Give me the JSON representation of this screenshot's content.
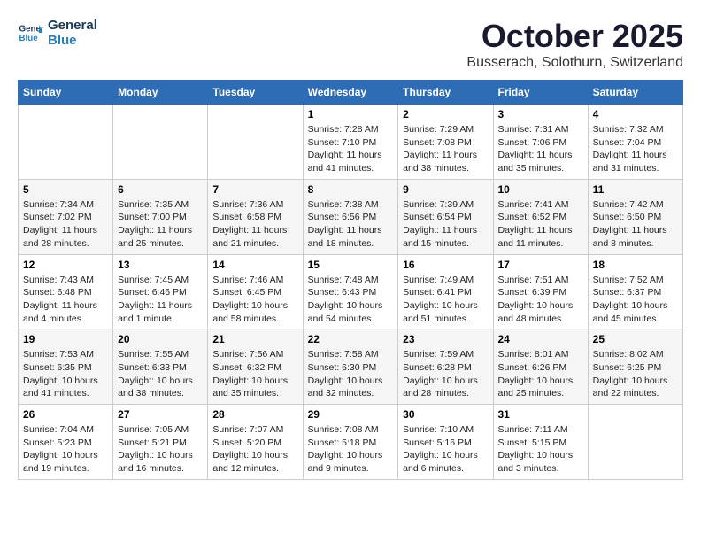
{
  "header": {
    "logo_line1": "General",
    "logo_line2": "Blue",
    "month": "October 2025",
    "location": "Busserach, Solothurn, Switzerland"
  },
  "days_of_week": [
    "Sunday",
    "Monday",
    "Tuesday",
    "Wednesday",
    "Thursday",
    "Friday",
    "Saturday"
  ],
  "weeks": [
    [
      {
        "day": "",
        "info": ""
      },
      {
        "day": "",
        "info": ""
      },
      {
        "day": "",
        "info": ""
      },
      {
        "day": "1",
        "sunrise": "7:28 AM",
        "sunset": "7:10 PM",
        "daylight": "11 hours and 41 minutes."
      },
      {
        "day": "2",
        "sunrise": "7:29 AM",
        "sunset": "7:08 PM",
        "daylight": "11 hours and 38 minutes."
      },
      {
        "day": "3",
        "sunrise": "7:31 AM",
        "sunset": "7:06 PM",
        "daylight": "11 hours and 35 minutes."
      },
      {
        "day": "4",
        "sunrise": "7:32 AM",
        "sunset": "7:04 PM",
        "daylight": "11 hours and 31 minutes."
      }
    ],
    [
      {
        "day": "5",
        "sunrise": "7:34 AM",
        "sunset": "7:02 PM",
        "daylight": "11 hours and 28 minutes."
      },
      {
        "day": "6",
        "sunrise": "7:35 AM",
        "sunset": "7:00 PM",
        "daylight": "11 hours and 25 minutes."
      },
      {
        "day": "7",
        "sunrise": "7:36 AM",
        "sunset": "6:58 PM",
        "daylight": "11 hours and 21 minutes."
      },
      {
        "day": "8",
        "sunrise": "7:38 AM",
        "sunset": "6:56 PM",
        "daylight": "11 hours and 18 minutes."
      },
      {
        "day": "9",
        "sunrise": "7:39 AM",
        "sunset": "6:54 PM",
        "daylight": "11 hours and 15 minutes."
      },
      {
        "day": "10",
        "sunrise": "7:41 AM",
        "sunset": "6:52 PM",
        "daylight": "11 hours and 11 minutes."
      },
      {
        "day": "11",
        "sunrise": "7:42 AM",
        "sunset": "6:50 PM",
        "daylight": "11 hours and 8 minutes."
      }
    ],
    [
      {
        "day": "12",
        "sunrise": "7:43 AM",
        "sunset": "6:48 PM",
        "daylight": "11 hours and 4 minutes."
      },
      {
        "day": "13",
        "sunrise": "7:45 AM",
        "sunset": "6:46 PM",
        "daylight": "11 hours and 1 minute."
      },
      {
        "day": "14",
        "sunrise": "7:46 AM",
        "sunset": "6:45 PM",
        "daylight": "10 hours and 58 minutes."
      },
      {
        "day": "15",
        "sunrise": "7:48 AM",
        "sunset": "6:43 PM",
        "daylight": "10 hours and 54 minutes."
      },
      {
        "day": "16",
        "sunrise": "7:49 AM",
        "sunset": "6:41 PM",
        "daylight": "10 hours and 51 minutes."
      },
      {
        "day": "17",
        "sunrise": "7:51 AM",
        "sunset": "6:39 PM",
        "daylight": "10 hours and 48 minutes."
      },
      {
        "day": "18",
        "sunrise": "7:52 AM",
        "sunset": "6:37 PM",
        "daylight": "10 hours and 45 minutes."
      }
    ],
    [
      {
        "day": "19",
        "sunrise": "7:53 AM",
        "sunset": "6:35 PM",
        "daylight": "10 hours and 41 minutes."
      },
      {
        "day": "20",
        "sunrise": "7:55 AM",
        "sunset": "6:33 PM",
        "daylight": "10 hours and 38 minutes."
      },
      {
        "day": "21",
        "sunrise": "7:56 AM",
        "sunset": "6:32 PM",
        "daylight": "10 hours and 35 minutes."
      },
      {
        "day": "22",
        "sunrise": "7:58 AM",
        "sunset": "6:30 PM",
        "daylight": "10 hours and 32 minutes."
      },
      {
        "day": "23",
        "sunrise": "7:59 AM",
        "sunset": "6:28 PM",
        "daylight": "10 hours and 28 minutes."
      },
      {
        "day": "24",
        "sunrise": "8:01 AM",
        "sunset": "6:26 PM",
        "daylight": "10 hours and 25 minutes."
      },
      {
        "day": "25",
        "sunrise": "8:02 AM",
        "sunset": "6:25 PM",
        "daylight": "10 hours and 22 minutes."
      }
    ],
    [
      {
        "day": "26",
        "sunrise": "7:04 AM",
        "sunset": "5:23 PM",
        "daylight": "10 hours and 19 minutes."
      },
      {
        "day": "27",
        "sunrise": "7:05 AM",
        "sunset": "5:21 PM",
        "daylight": "10 hours and 16 minutes."
      },
      {
        "day": "28",
        "sunrise": "7:07 AM",
        "sunset": "5:20 PM",
        "daylight": "10 hours and 12 minutes."
      },
      {
        "day": "29",
        "sunrise": "7:08 AM",
        "sunset": "5:18 PM",
        "daylight": "10 hours and 9 minutes."
      },
      {
        "day": "30",
        "sunrise": "7:10 AM",
        "sunset": "5:16 PM",
        "daylight": "10 hours and 6 minutes."
      },
      {
        "day": "31",
        "sunrise": "7:11 AM",
        "sunset": "5:15 PM",
        "daylight": "10 hours and 3 minutes."
      },
      {
        "day": "",
        "info": ""
      }
    ]
  ],
  "labels": {
    "sunrise": "Sunrise:",
    "sunset": "Sunset:",
    "daylight": "Daylight:"
  }
}
